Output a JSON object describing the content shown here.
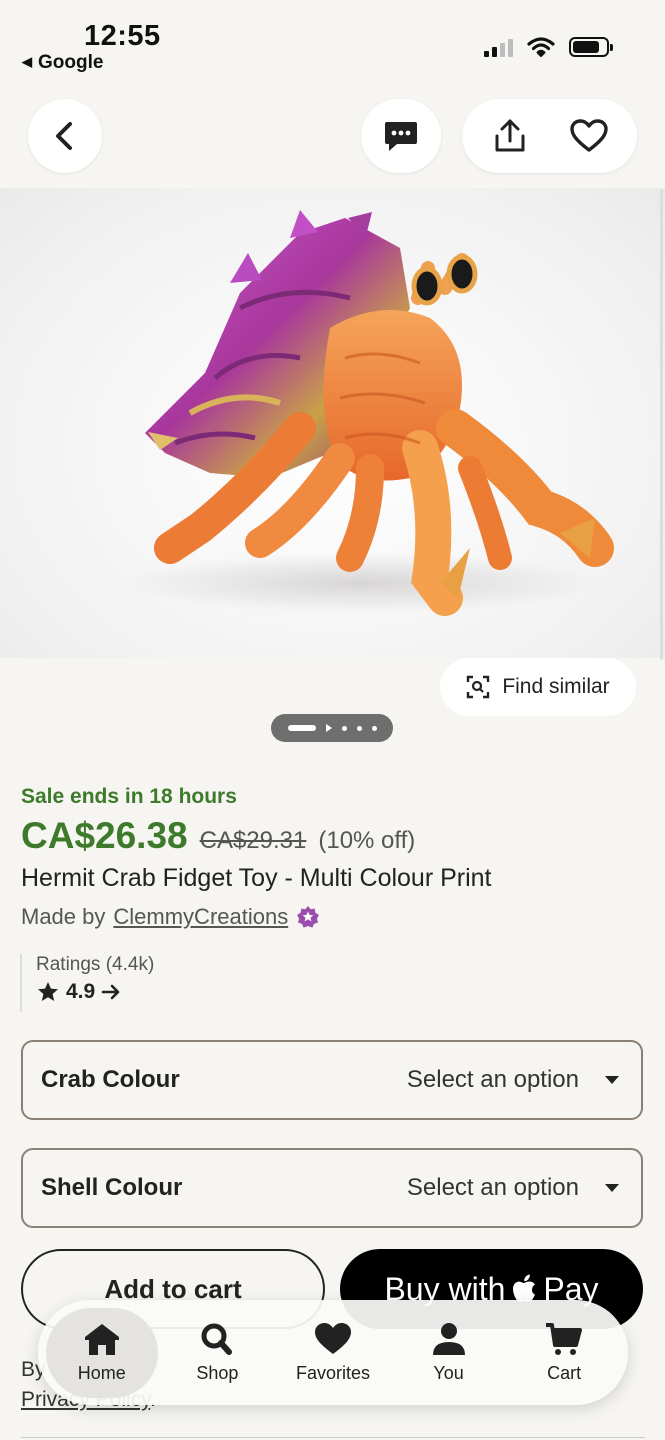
{
  "status_bar": {
    "time": "12:55",
    "back_app": "Google"
  },
  "product": {
    "sale_text": "Sale ends in 18 hours",
    "price": "CA$26.38",
    "original_price": "CA$29.31",
    "discount": "(10% off)",
    "title": "Hermit Crab Fidget Toy - Multi Colour Print",
    "made_by_prefix": "Made by",
    "shop_name": "ClemmyCreations",
    "ratings_label": "Ratings (4.4k)",
    "rating_value": "4.9"
  },
  "image_actions": {
    "find_similar": "Find similar"
  },
  "variations": [
    {
      "name": "Crab Colour",
      "value": "Select an option"
    },
    {
      "name": "Shell Colour",
      "value": "Select an option"
    }
  ],
  "actions": {
    "add_to_cart": "Add to cart",
    "buy_with": "Buy with",
    "pay": "Pay"
  },
  "legal": {
    "prefix": "By",
    "link": "Privacy Policy",
    "suffix": "."
  },
  "nav": {
    "items": [
      {
        "label": "Home",
        "icon": "home-icon"
      },
      {
        "label": "Shop",
        "icon": "search-icon"
      },
      {
        "label": "Favorites",
        "icon": "heart-icon"
      },
      {
        "label": "You",
        "icon": "person-icon"
      },
      {
        "label": "Cart",
        "icon": "cart-icon"
      }
    ]
  },
  "colors": {
    "sale_green": "#3d7a2b",
    "star_seller": "#9b4dae"
  }
}
